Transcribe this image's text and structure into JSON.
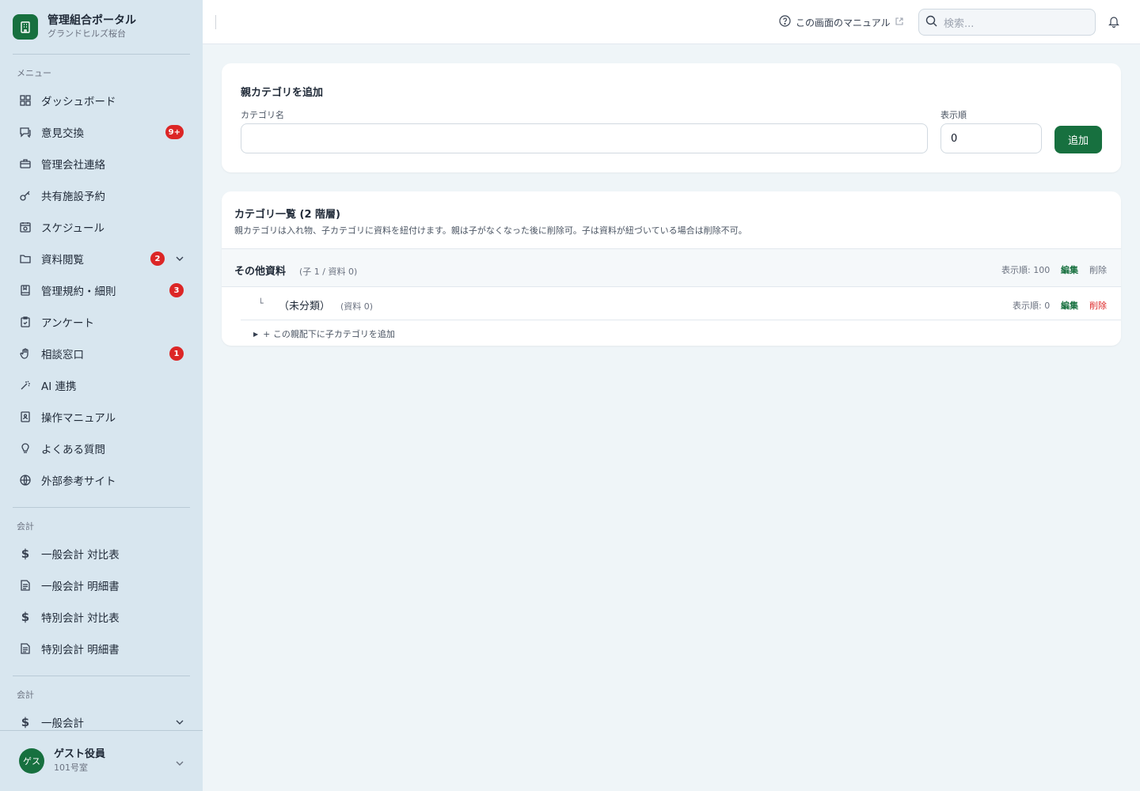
{
  "brand": {
    "title": "管理組合ポータル",
    "subtitle": "グランドヒルズ桜台"
  },
  "sidebar": {
    "menu_label": "メニュー",
    "items": [
      {
        "label": "ダッシュボード",
        "icon": "dashboard-icon"
      },
      {
        "label": "意見交換",
        "icon": "chat-icon",
        "badge": "9+"
      },
      {
        "label": "管理会社連絡",
        "icon": "briefcase-icon"
      },
      {
        "label": "共有施設予約",
        "icon": "key-icon"
      },
      {
        "label": "スケジュール",
        "icon": "calendar-icon"
      },
      {
        "label": "資料閲覧",
        "icon": "folder-icon",
        "badge": "2"
      },
      {
        "label": "管理規約・細則",
        "icon": "book-icon",
        "badge": "3"
      },
      {
        "label": "アンケート",
        "icon": "clipboard-icon"
      },
      {
        "label": "相談窓口",
        "icon": "hand-icon",
        "badge": "1"
      },
      {
        "label": "AI 連携",
        "icon": "sparkle-icon"
      },
      {
        "label": "操作マニュアル",
        "icon": "manual-icon"
      },
      {
        "label": "よくある質問",
        "icon": "lightbulb-icon"
      },
      {
        "label": "外部参考サイト",
        "icon": "globe-icon"
      }
    ],
    "accounting_label": "会計",
    "accounting_items": [
      {
        "label": "一般会計 対比表",
        "icon": "dollar-icon"
      },
      {
        "label": "一般会計 明細書",
        "icon": "document-icon"
      },
      {
        "label": "特別会計 対比表",
        "icon": "dollar-icon"
      },
      {
        "label": "特別会計 明細書",
        "icon": "document-icon"
      }
    ],
    "accounting2_label": "会計",
    "accounting2_items": [
      {
        "label": "一般会計",
        "icon": "dollar-icon"
      }
    ]
  },
  "user": {
    "avatar": "ゲス",
    "name": "ゲスト役員",
    "room": "101号室"
  },
  "topbar": {
    "manual_link": "この画面のマニュアル",
    "search_placeholder": "検索..."
  },
  "add_form": {
    "title": "親カテゴリを追加",
    "name_label": "カテゴリ名",
    "name_value": "",
    "order_label": "表示順",
    "order_value": "0",
    "add_button": "追加"
  },
  "category_list": {
    "title": "カテゴリ一覧 (2 階層)",
    "description": "親カテゴリは入れ物、子カテゴリに資料を紐付けます。親は子がなくなった後に削除可。子は資料が紐づいている場合は削除不可。",
    "parent": {
      "name": "その他資料",
      "meta": "(子 1 / 資料 0)",
      "order": "表示順: 100",
      "edit": "編集",
      "delete": "削除"
    },
    "child": {
      "corner": "└",
      "name": "（未分類）",
      "meta": "(資料 0)",
      "order": "表示順: 0",
      "edit": "編集",
      "delete": "削除"
    },
    "add_child": "+ この親配下に子カテゴリを追加"
  },
  "colors": {
    "brand_green": "#17703f",
    "badge_red": "#dc2626",
    "sidebar_bg": "#d8e6ef",
    "page_bg": "#eff5f8"
  }
}
